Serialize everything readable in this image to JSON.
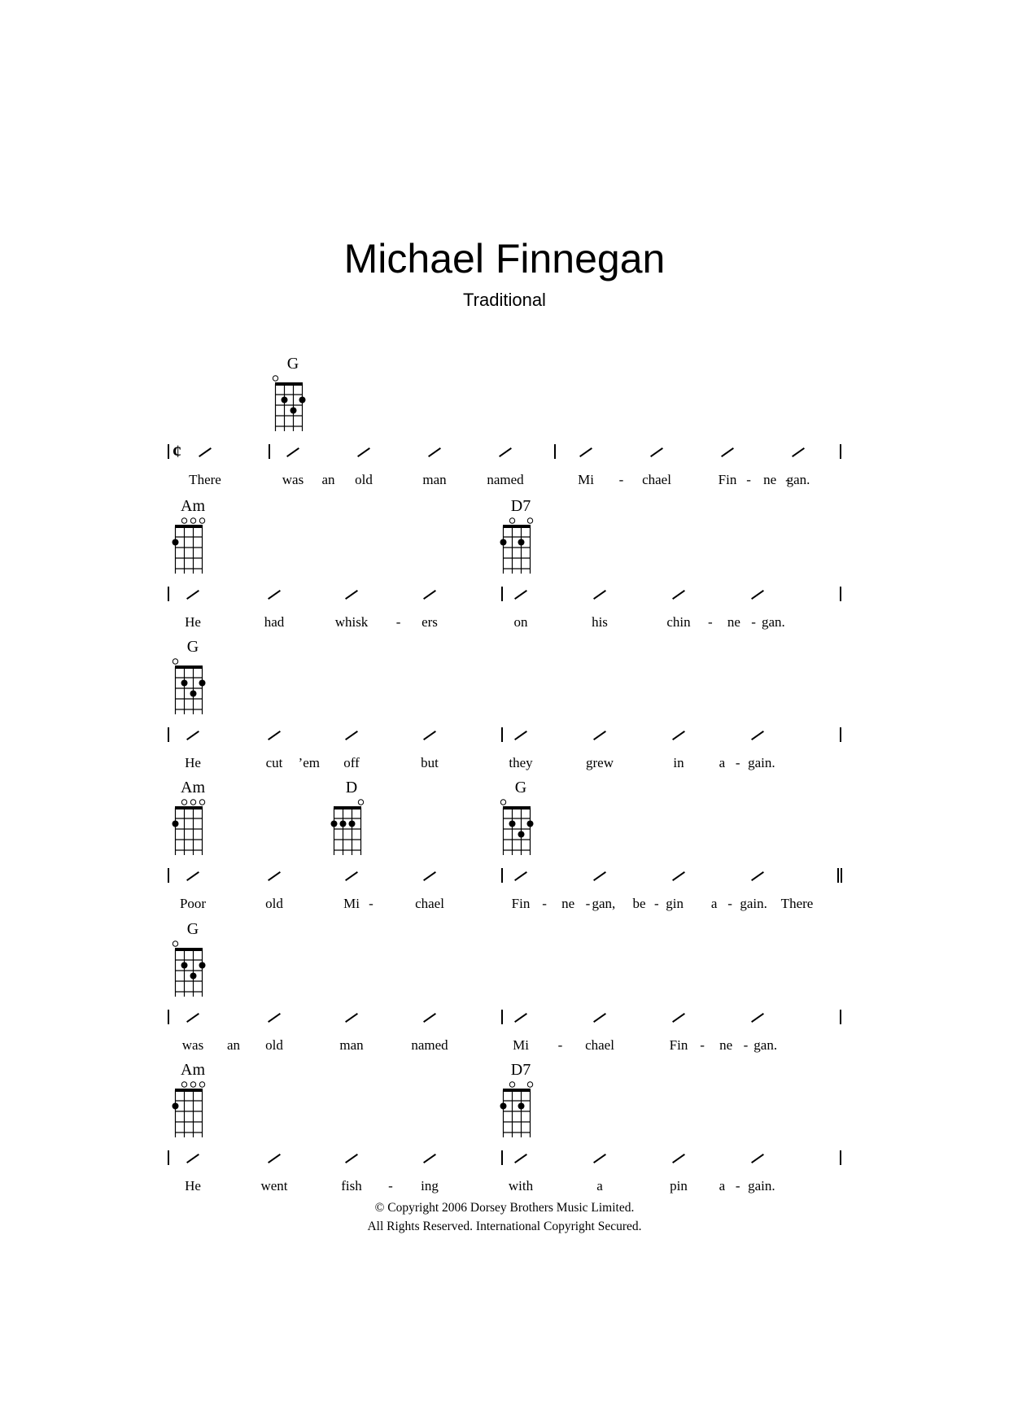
{
  "title": "Michael Finnegan",
  "composer": "Traditional",
  "time_signature_symbol": "¢",
  "chord_shapes": {
    "G": {
      "open": [
        0
      ],
      "dots": [
        [
          1,
          2
        ],
        [
          3,
          2
        ],
        [
          2,
          3
        ]
      ]
    },
    "Am": {
      "open": [
        1,
        2,
        3
      ],
      "dots": [
        [
          0,
          2
        ]
      ]
    },
    "D7": {
      "open": [
        1,
        3
      ],
      "dots": [
        [
          0,
          2
        ],
        [
          2,
          2
        ]
      ]
    },
    "D": {
      "open": [
        3
      ],
      "dots": [
        [
          0,
          2
        ],
        [
          1,
          2
        ],
        [
          2,
          2
        ]
      ]
    }
  },
  "systems": [
    {
      "chords": [
        {
          "name": "G",
          "slash": 1
        }
      ],
      "lyrics": [
        {
          "text": "There",
          "slash": 0
        },
        {
          "text": "was",
          "slash": 1
        },
        {
          "text": "an",
          "slash": 1.5
        },
        {
          "text": "old",
          "slash": 2
        },
        {
          "text": "man",
          "slash": 3
        },
        {
          "text": "named",
          "slash": 4
        },
        {
          "text": "Mi",
          "slash": 5
        },
        {
          "text": "-",
          "slash": 5.5
        },
        {
          "text": "chael",
          "slash": 6
        },
        {
          "text": "Fin",
          "slash": 7
        },
        {
          "text": "-",
          "slash": 7.3
        },
        {
          "text": "ne",
          "slash": 7.6
        },
        {
          "text": "-",
          "slash": 7.85
        },
        {
          "text": "gan.",
          "slash": 8.1
        }
      ],
      "end_bar": "single"
    },
    {
      "chords": [
        {
          "name": "Am",
          "slash": 0
        },
        {
          "name": "D7",
          "slash": 4
        }
      ],
      "lyrics": [
        {
          "text": "He",
          "slash": 0
        },
        {
          "text": "had",
          "slash": 1
        },
        {
          "text": "whisk",
          "slash": 2
        },
        {
          "text": "-",
          "slash": 2.6
        },
        {
          "text": "ers",
          "slash": 3
        },
        {
          "text": "on",
          "slash": 4
        },
        {
          "text": "his",
          "slash": 5
        },
        {
          "text": "chin",
          "slash": 6
        },
        {
          "text": "-",
          "slash": 6.4
        },
        {
          "text": "ne",
          "slash": 6.7
        },
        {
          "text": "-",
          "slash": 6.95
        },
        {
          "text": "gan.",
          "slash": 7.2
        }
      ],
      "end_bar": "single"
    },
    {
      "chords": [
        {
          "name": "G",
          "slash": 0
        }
      ],
      "lyrics": [
        {
          "text": "He",
          "slash": 0
        },
        {
          "text": "cut",
          "slash": 1
        },
        {
          "text": "’em",
          "slash": 1.45
        },
        {
          "text": "off",
          "slash": 2
        },
        {
          "text": "but",
          "slash": 3
        },
        {
          "text": "they",
          "slash": 4
        },
        {
          "text": "grew",
          "slash": 5
        },
        {
          "text": "in",
          "slash": 6
        },
        {
          "text": "a",
          "slash": 6.55
        },
        {
          "text": "-",
          "slash": 6.75
        },
        {
          "text": "gain.",
          "slash": 7.05
        }
      ],
      "end_bar": "single"
    },
    {
      "chords": [
        {
          "name": "Am",
          "slash": 0
        },
        {
          "name": "D",
          "slash": 2
        },
        {
          "name": "G",
          "slash": 4
        }
      ],
      "lyrics": [
        {
          "text": "Poor",
          "slash": 0
        },
        {
          "text": "old",
          "slash": 1
        },
        {
          "text": "Mi",
          "slash": 2
        },
        {
          "text": "-",
          "slash": 2.25
        },
        {
          "text": "chael",
          "slash": 3
        },
        {
          "text": "Fin",
          "slash": 4
        },
        {
          "text": "-",
          "slash": 4.3
        },
        {
          "text": "ne",
          "slash": 4.6
        },
        {
          "text": "-",
          "slash": 4.85
        },
        {
          "text": "gan,",
          "slash": 5.05
        },
        {
          "text": "be",
          "slash": 5.5
        },
        {
          "text": "-",
          "slash": 5.72
        },
        {
          "text": "gin",
          "slash": 5.95
        },
        {
          "text": "a",
          "slash": 6.45
        },
        {
          "text": "-",
          "slash": 6.65
        },
        {
          "text": "gain.",
          "slash": 6.95
        },
        {
          "text": "There",
          "slash": 7.5
        }
      ],
      "end_bar": "double"
    },
    {
      "chords": [
        {
          "name": "G",
          "slash": 0
        }
      ],
      "lyrics": [
        {
          "text": "was",
          "slash": 0
        },
        {
          "text": "an",
          "slash": 0.5
        },
        {
          "text": "old",
          "slash": 1
        },
        {
          "text": "man",
          "slash": 2
        },
        {
          "text": "named",
          "slash": 3
        },
        {
          "text": "Mi",
          "slash": 4
        },
        {
          "text": "-",
          "slash": 4.5
        },
        {
          "text": "chael",
          "slash": 5
        },
        {
          "text": "Fin",
          "slash": 6
        },
        {
          "text": "-",
          "slash": 6.3
        },
        {
          "text": "ne",
          "slash": 6.6
        },
        {
          "text": "-",
          "slash": 6.85
        },
        {
          "text": "gan.",
          "slash": 7.1
        }
      ],
      "end_bar": "single"
    },
    {
      "chords": [
        {
          "name": "Am",
          "slash": 0
        },
        {
          "name": "D7",
          "slash": 4
        }
      ],
      "lyrics": [
        {
          "text": "He",
          "slash": 0
        },
        {
          "text": "went",
          "slash": 1
        },
        {
          "text": "fish",
          "slash": 2
        },
        {
          "text": "-",
          "slash": 2.5
        },
        {
          "text": "ing",
          "slash": 3
        },
        {
          "text": "with",
          "slash": 4
        },
        {
          "text": "a",
          "slash": 5
        },
        {
          "text": "pin",
          "slash": 6
        },
        {
          "text": "a",
          "slash": 6.55
        },
        {
          "text": "-",
          "slash": 6.75
        },
        {
          "text": "gain.",
          "slash": 7.05
        }
      ],
      "end_bar": "single"
    }
  ],
  "copyright": {
    "line1": "© Copyright 2006 Dorsey Brothers Music Limited.",
    "line2": "All Rights Reserved. International Copyright Secured."
  }
}
